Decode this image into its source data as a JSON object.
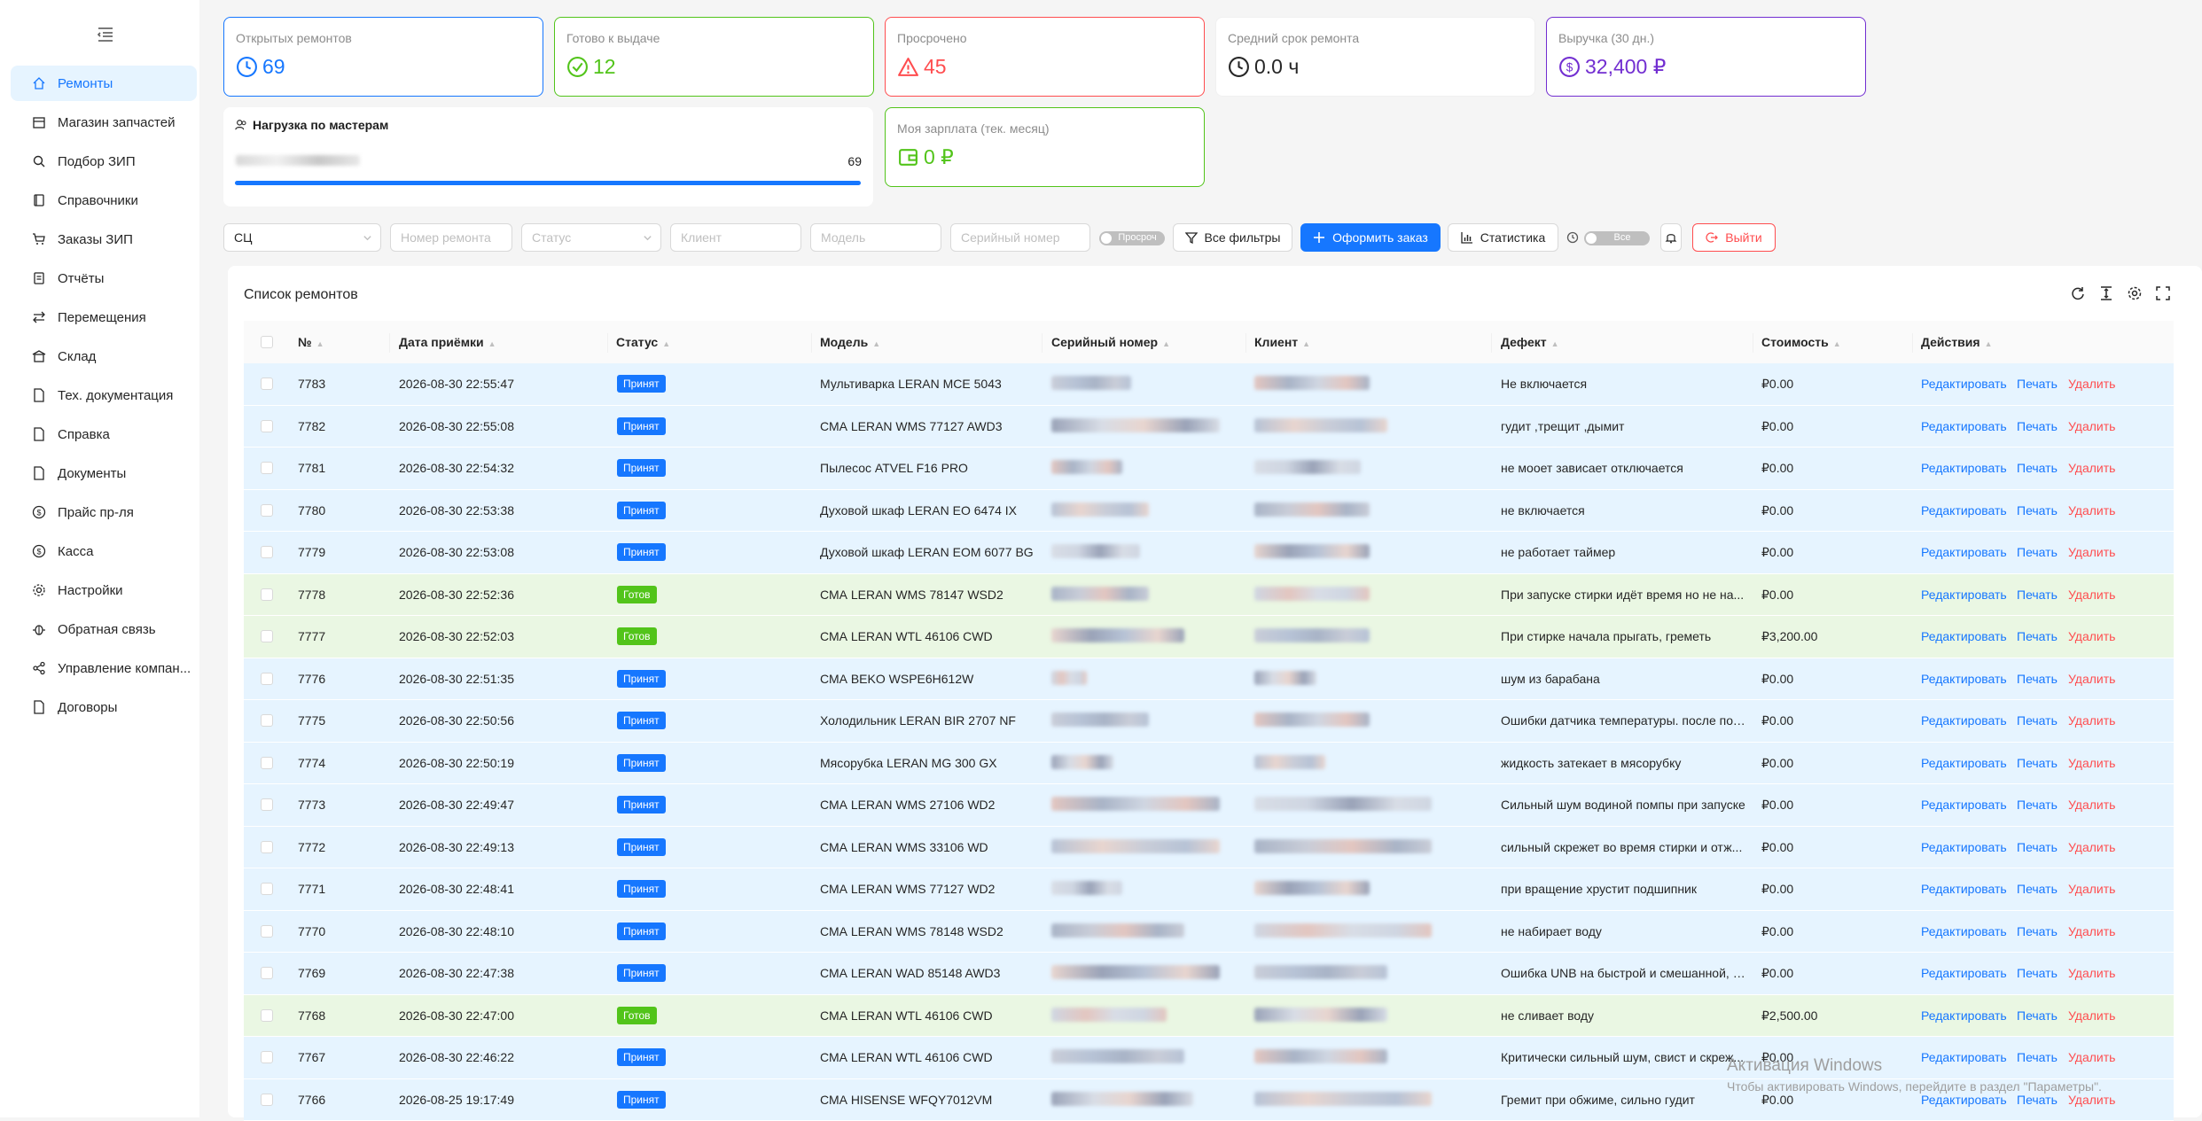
{
  "nav": {
    "items": [
      {
        "label": "Ремонты",
        "icon": "home-icon"
      },
      {
        "label": "Магазин запчастей",
        "icon": "shop-icon"
      },
      {
        "label": "Подбор ЗИП",
        "icon": "search-icon"
      },
      {
        "label": "Справочники",
        "icon": "book-icon"
      },
      {
        "label": "Заказы ЗИП",
        "icon": "cart-icon"
      },
      {
        "label": "Отчёты",
        "icon": "report-icon"
      },
      {
        "label": "Перемещения",
        "icon": "transfer-icon"
      },
      {
        "label": "Склад",
        "icon": "warehouse-icon"
      },
      {
        "label": "Тех. документация",
        "icon": "file-icon"
      },
      {
        "label": "Справка",
        "icon": "file-icon"
      },
      {
        "label": "Документы",
        "icon": "file-icon"
      },
      {
        "label": "Прайс пр-ля",
        "icon": "dollar-icon"
      },
      {
        "label": "Касса",
        "icon": "dollar-icon"
      },
      {
        "label": "Настройки",
        "icon": "gear-icon"
      },
      {
        "label": "Обратная связь",
        "icon": "bug-icon"
      },
      {
        "label": "Управление компан...",
        "icon": "share-icon"
      },
      {
        "label": "Договоры",
        "icon": "file-icon"
      }
    ]
  },
  "stats": {
    "open": {
      "title": "Открытых ремонтов",
      "value": "69",
      "color": "#1677ff"
    },
    "ready": {
      "title": "Готово к выдаче",
      "value": "12",
      "color": "#52c41a"
    },
    "overdue": {
      "title": "Просрочено",
      "value": "45",
      "color": "#ff4d4f"
    },
    "avg": {
      "title": "Средний срок ремонта",
      "value": "0.0 ч",
      "color": "#262626"
    },
    "revenue": {
      "title": "Выручка (30 дн.)",
      "value": "32,400 ₽",
      "color": "#722ed1"
    },
    "salary": {
      "title": "Моя зарплата (тек. месяц)",
      "value": "0 ₽",
      "color": "#52c41a"
    }
  },
  "workload": {
    "title": "Нагрузка по мастерам",
    "count": "69",
    "fill": 1.0
  },
  "filters": {
    "service_center": "СЦ",
    "repair_number": "Номер ремонта",
    "status": "Статус",
    "client": "Клиент",
    "model": "Модель",
    "serial": "Серийный номер",
    "overdue_toggle": "Просроч",
    "all_filters": "Все фильтры",
    "create_order": "Оформить заказ",
    "statistics": "Статистика",
    "all_toggle": "Все",
    "logout": "Выйти"
  },
  "table": {
    "title": "Список ремонтов",
    "columns": [
      "№",
      "Дата приёмки",
      "Статус",
      "Модель",
      "Серийный номер",
      "Клиент",
      "Дефект",
      "Стоимость",
      "Действия"
    ],
    "actions": {
      "edit": "Редактировать",
      "print": "Печать",
      "delete": "Удалить"
    },
    "rows": [
      {
        "num": "7783",
        "date": "2026-08-30 22:55:47",
        "status": "Принят",
        "model": "Мультиварка LERAN MCE 5043",
        "defect": "Не включается",
        "cost": "₽0.00"
      },
      {
        "num": "7782",
        "date": "2026-08-30 22:55:08",
        "status": "Принят",
        "model": "СМА LERAN WMS 77127 AWD3",
        "defect": "гудит ,трещит ,дымит",
        "cost": "₽0.00"
      },
      {
        "num": "7781",
        "date": "2026-08-30 22:54:32",
        "status": "Принят",
        "model": "Пылесос ATVEL F16 PRO",
        "defect": "не моoет зависает отключается",
        "cost": "₽0.00"
      },
      {
        "num": "7780",
        "date": "2026-08-30 22:53:38",
        "status": "Принят",
        "model": "Духовой шкаф LERAN EO 6474 IX",
        "defect": "не включается",
        "cost": "₽0.00"
      },
      {
        "num": "7779",
        "date": "2026-08-30 22:53:08",
        "status": "Принят",
        "model": "Духовой шкаф LERAN EOM 6077 BG",
        "defect": "не работает таймер",
        "cost": "₽0.00"
      },
      {
        "num": "7778",
        "date": "2026-08-30 22:52:36",
        "status": "Готов",
        "model": "СМА LERAN WMS 78147 WSD2",
        "defect": "При запуске стирки идёт время но не на...",
        "cost": "₽0.00"
      },
      {
        "num": "7777",
        "date": "2026-08-30 22:52:03",
        "status": "Готов",
        "model": "СМА LERAN WTL 46106 CWD",
        "defect": "При стирке начала прыгать, греметь",
        "cost": "₽3,200.00"
      },
      {
        "num": "7776",
        "date": "2026-08-30 22:51:35",
        "status": "Принят",
        "model": "СМА BEKO WSPE6H612W",
        "defect": "шум из барабана",
        "cost": "₽0.00"
      },
      {
        "num": "7775",
        "date": "2026-08-30 22:50:56",
        "status": "Принят",
        "model": "Холодильник LERAN BIR 2707 NF",
        "defect": "Ошибки датчика температуры. после пол...",
        "cost": "₽0.00"
      },
      {
        "num": "7774",
        "date": "2026-08-30 22:50:19",
        "status": "Принят",
        "model": "Мясорубка LERAN MG 300 GX",
        "defect": "жидкость затекает в мясорубку",
        "cost": "₽0.00"
      },
      {
        "num": "7773",
        "date": "2026-08-30 22:49:47",
        "status": "Принят",
        "model": "СМА LERAN WMS 27106 WD2",
        "defect": "Сильный шум водиной помпы при запуске",
        "cost": "₽0.00"
      },
      {
        "num": "7772",
        "date": "2026-08-30 22:49:13",
        "status": "Принят",
        "model": "СМА LERAN WMS 33106 WD",
        "defect": "сильный скрежет во время стирки и отж...",
        "cost": "₽0.00"
      },
      {
        "num": "7771",
        "date": "2026-08-30 22:48:41",
        "status": "Принят",
        "model": "СМА LERAN WMS 77127 WD2",
        "defect": "при вращение хрустит подшипник",
        "cost": "₽0.00"
      },
      {
        "num": "7770",
        "date": "2026-08-30 22:48:10",
        "status": "Принят",
        "model": "СМА LERAN WMS 78148 WSD2",
        "defect": "не набирает воду",
        "cost": "₽0.00"
      },
      {
        "num": "7769",
        "date": "2026-08-30 22:47:38",
        "status": "Принят",
        "model": "СМА LERAN WAD 85148 AWD3",
        "defect": "Ошибка UNB на быстрой и смешанной, н...",
        "cost": "₽0.00"
      },
      {
        "num": "7768",
        "date": "2026-08-30 22:47:00",
        "status": "Готов",
        "model": "СМА LERAN WTL 46106 CWD",
        "defect": "не сливает воду",
        "cost": "₽2,500.00"
      },
      {
        "num": "7767",
        "date": "2026-08-30 22:46:22",
        "status": "Принят",
        "model": "СМА LERAN WTL 46106 CWD",
        "defect": "Критически сильный шум, свист и скреж...",
        "cost": "₽0.00"
      },
      {
        "num": "7766",
        "date": "2026-08-25 19:17:49",
        "status": "Принят",
        "model": "СМА HISENSE WFQY7012VM",
        "defect": "Гремит при обжиме, сильно гудит",
        "cost": "₽0.00"
      }
    ]
  },
  "watermark": {
    "line1": "Активация Windows",
    "line2": "Чтобы активировать Windows, перейдите в раздел \"Параметры\"."
  }
}
